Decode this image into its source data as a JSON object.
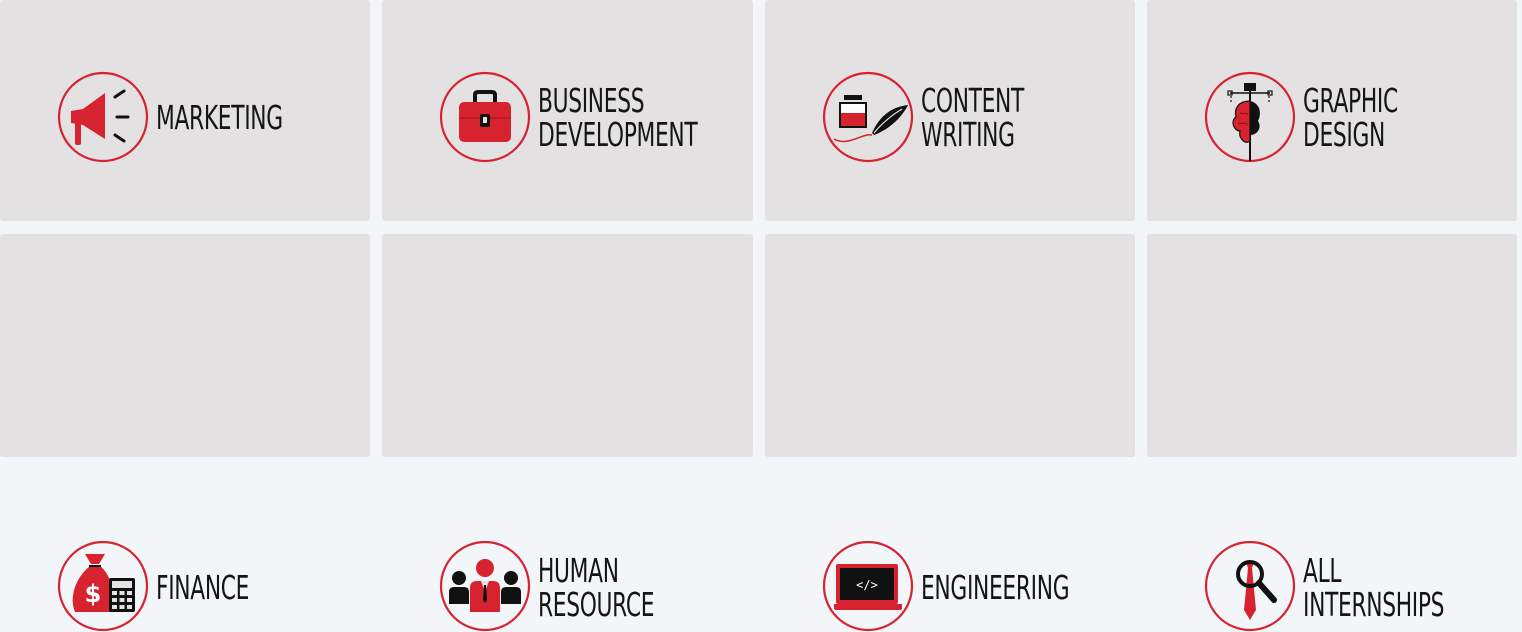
{
  "categories": [
    {
      "line1": "MARKETING",
      "line2": "",
      "icon": "megaphone-icon"
    },
    {
      "line1": "BUSINESS",
      "line2": "DEVELOPMENT",
      "icon": "briefcase-icon"
    },
    {
      "line1": "CONTENT",
      "line2": "WRITING",
      "icon": "ink-quill-icon"
    },
    {
      "line1": "GRAPHIC",
      "line2": "DESIGN",
      "icon": "pen-tool-brain-icon"
    },
    {
      "line1": "FINANCE",
      "line2": "",
      "icon": "money-bag-calculator-icon"
    },
    {
      "line1": "HUMAN",
      "line2": "RESOURCE",
      "icon": "people-group-icon"
    },
    {
      "line1": "ENGINEERING",
      "line2": "",
      "icon": "laptop-code-icon"
    },
    {
      "line1": "ALL",
      "line2": "INTERNSHIPS",
      "icon": "magnifier-tie-icon"
    }
  ],
  "colors": {
    "accent": "#d6232f",
    "card_bg": "#e3e1e2",
    "page_bg": "#f2f6f9",
    "text": "#151515"
  }
}
